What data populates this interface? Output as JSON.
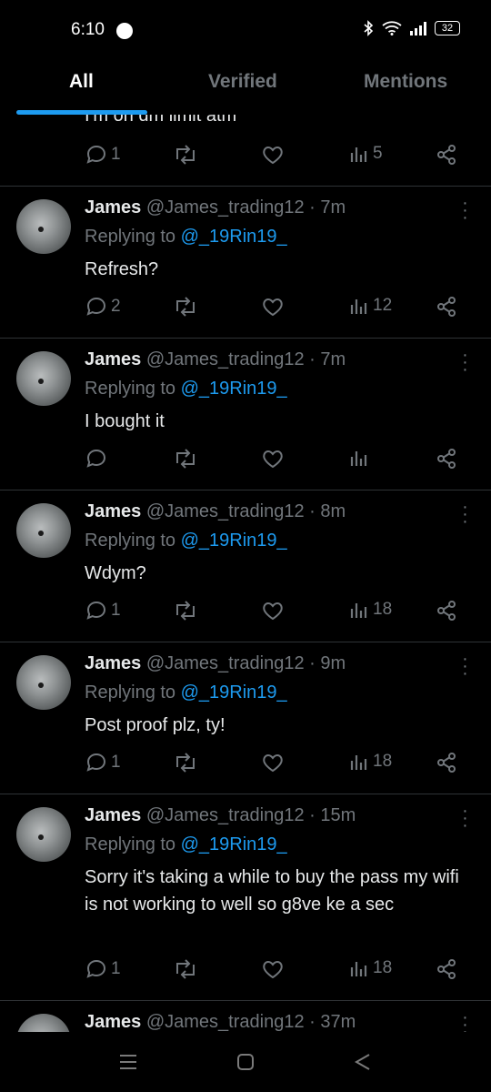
{
  "status_bar": {
    "time": "6:10",
    "battery": "32"
  },
  "tabs": [
    {
      "label": "All",
      "active": true
    },
    {
      "label": "Verified",
      "active": false
    },
    {
      "label": "Mentions",
      "active": false
    }
  ],
  "partial_tweet": {
    "text": "I'm on dm limit atm",
    "replies": "1",
    "views": "5"
  },
  "tweets": [
    {
      "name": "James",
      "handle": "@James_trading12",
      "dot": "·",
      "time": "7m",
      "replying_prefix": "Replying to",
      "replying_to": "@_19Rin19_",
      "text": "Refresh?",
      "replies": "2",
      "views": "12"
    },
    {
      "name": "James",
      "handle": "@James_trading12",
      "dot": "·",
      "time": "7m",
      "replying_prefix": "Replying to",
      "replying_to": "@_19Rin19_",
      "text": "I bought it",
      "replies": "",
      "views": ""
    },
    {
      "name": "James",
      "handle": "@James_trading12",
      "dot": "·",
      "time": "8m",
      "replying_prefix": "Replying to",
      "replying_to": "@_19Rin19_",
      "text": "Wdym?",
      "replies": "1",
      "views": "18"
    },
    {
      "name": "James",
      "handle": "@James_trading12",
      "dot": "·",
      "time": "9m",
      "replying_prefix": "Replying to",
      "replying_to": "@_19Rin19_",
      "text": "Post proof plz, ty!",
      "replies": "1",
      "views": "18"
    },
    {
      "name": "James",
      "handle": "@James_trading12",
      "dot": "·",
      "time": "15m",
      "replying_prefix": "Replying to",
      "replying_to": "@_19Rin19_",
      "text": "Sorry it's taking a while to buy the pass my wifi is not working to well so g8ve ke a sec",
      "replies": "1",
      "views": "18"
    },
    {
      "name": "James",
      "handle": "@James_trading12",
      "dot": "·",
      "time": "37m",
      "replying_prefix": "",
      "replying_to": "",
      "text": "",
      "replies": "",
      "views": ""
    }
  ],
  "colors": {
    "accent": "#1d9bf0",
    "muted": "#71767b",
    "background": "#000000"
  }
}
